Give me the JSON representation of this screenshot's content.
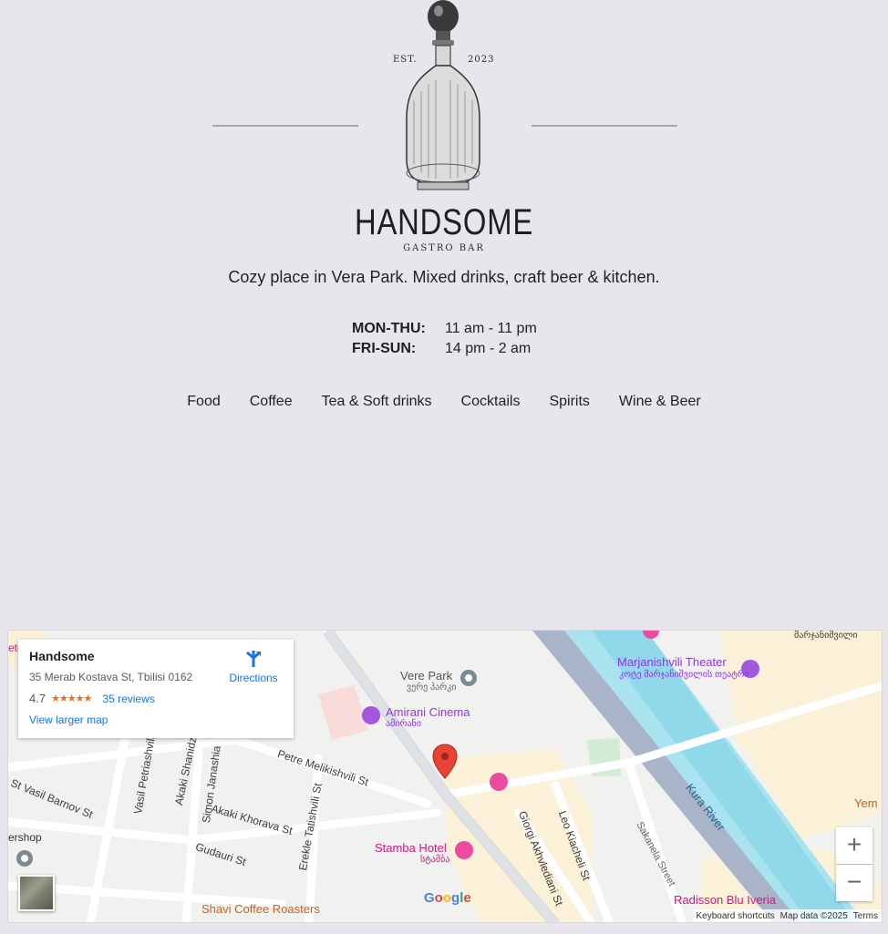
{
  "header": {
    "est_left": "EST.",
    "est_right": "2023",
    "brand_name": "HANDSOME",
    "brand_sub": "GASTRO BAR",
    "tagline": "Cozy place in Vera Park. Mixed drinks, craft beer & kitchen."
  },
  "hours": [
    {
      "day": "MON-THU:",
      "time": "11 am - 11 pm"
    },
    {
      "day": "FRI-SUN:",
      "time": "14 pm - 2 am"
    }
  ],
  "nav": [
    "Food",
    "Coffee",
    "Tea & Soft drinks",
    "Cocktails",
    "Spirits",
    "Wine & Beer"
  ],
  "map": {
    "place_name": "Handsome",
    "address": "35 Merab Kostava St, Tbilisi 0162",
    "rating": "4.7",
    "stars": "★★★★★",
    "reviews": "35 reviews",
    "larger_map": "View larger map",
    "directions": "Directions",
    "zoom_in": "+",
    "zoom_out": "−",
    "google": "Google",
    "keyboard": "Keyboard shortcuts",
    "map_data": "Map data ©2025",
    "terms": "Terms",
    "labels": {
      "vere_park": "Vere Park",
      "vere_park_ka": "ვერე პარკი",
      "amirani": "Amirani Cinema",
      "amirani_ka": "ამირანი",
      "marjanishvili": "Marjanishvili Theater",
      "marjanishvili_ka": "კოტე მარჯანიშვილის თეატრი",
      "stamba": "Stamba Hotel",
      "stamba_ka": "სტამბა",
      "radisson": "Radisson Blu Iveria",
      "shavi": "Shavi Coffee Roasters",
      "kura": "Kura River",
      "petre": "Petre Melikishvili St",
      "vasil_barnov": "St Vasil Barnov St",
      "vasil_petriashvili": "Vasil Petriashvili",
      "akaki_shanidze": "Akaki Shanidze",
      "simon": "Simon Janashia",
      "akaki_khorava": "Akaki Khorava St",
      "tatishvili": "Erekle Tatishvili St",
      "gudauri": "Gudauri St",
      "giorgi": "Giorgi Akhvlediani St",
      "leo": "Leo Kiacheli St",
      "sakanela": "Sakanela Street",
      "ershop": "ershop",
      "marjanishvili_top": "მარჯანიშვილი",
      "tete": "ete",
      "yem": "Yem"
    }
  }
}
